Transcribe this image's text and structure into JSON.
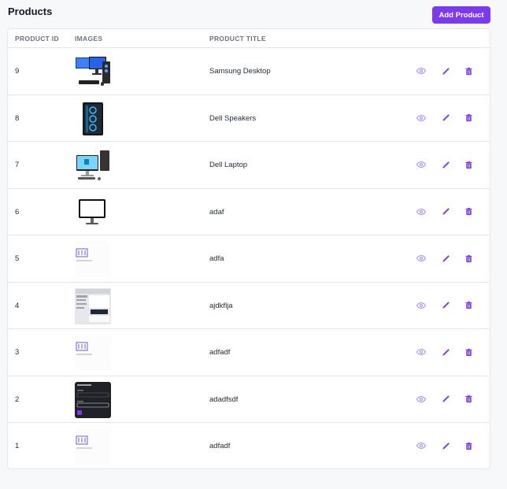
{
  "page": {
    "title": "Products",
    "add_button": "Add Product"
  },
  "table": {
    "columns": [
      "PRODUCT ID",
      "IMAGES",
      "PRODUCT TITLE"
    ],
    "rows": [
      {
        "id": "9",
        "title": "Samsung Desktop",
        "image": "desktop-computer-image"
      },
      {
        "id": "8",
        "title": "Dell Speakers",
        "image": "pc-tower-image"
      },
      {
        "id": "7",
        "title": "Dell Laptop",
        "image": "all-in-one-pc-image"
      },
      {
        "id": "6",
        "title": "adaf",
        "image": "monitor-image"
      },
      {
        "id": "5",
        "title": "adfa",
        "image": "generic-thumbnail-image"
      },
      {
        "id": "4",
        "title": "ajdkflja",
        "image": "screenshot-thumbnail-image"
      },
      {
        "id": "3",
        "title": "adfadf",
        "image": "generic-thumbnail-image"
      },
      {
        "id": "2",
        "title": "adadfsdf",
        "image": "dark-form-thumbnail-image"
      },
      {
        "id": "1",
        "title": "adfadf",
        "image": "generic-thumbnail-image"
      }
    ]
  },
  "actions": {
    "view_icon": "eye-icon",
    "edit_icon": "pencil-icon",
    "delete_icon": "trash-icon"
  },
  "colors": {
    "accent": "#7c3aed",
    "view_icon": "#a78bfa",
    "row_border": "#e5e7eb"
  }
}
